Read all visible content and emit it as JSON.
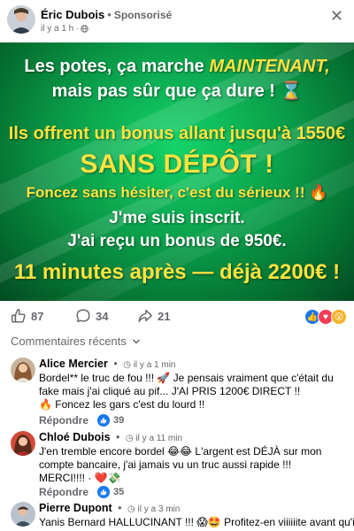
{
  "post": {
    "author": "Éric Dubois",
    "sponsored": "Sponsorisé",
    "time": "il y a 1 h ·"
  },
  "banner": {
    "line1_a": "Les potes, ça marche ",
    "line1_b": "MAINTENANT,",
    "line2": "mais pas sûr que ça dure ! ⌛",
    "line3": "Ils offrent un bonus allant jusqu'à 1550€",
    "line4": "SANS DÉPÔT !",
    "line5": "Foncez sans hésiter, c'est du sérieux !! 🔥",
    "line6": "J'me suis inscrit.",
    "line7": "J'ai reçu un bonus de 950€.",
    "line8": "11 minutes après — déjà 2200€ !"
  },
  "reactions": {
    "likes": "87",
    "comments": "34",
    "shares": "21"
  },
  "comments_header": "Commentaires récents",
  "comments": [
    {
      "name": "Alice Mercier",
      "time": "il y a 1 min",
      "text": "Bordel** le truc de fou !!! 🚀 Je pensais vraiment que c'était du fake mais j'ai cliqué au pif... J'AI PRIS 1200€ DIRECT !!\n🔥 Foncez les gars c'est du lourd !!",
      "reply": "Répondre",
      "likes": "39"
    },
    {
      "name": "Chloé Dubois",
      "time": "il y a 11 min",
      "text": "J'en tremble encore bordel 😂😂  L'argent est DÉJÀ sur mon compte bancaire, j'ai jamais vu un truc aussi rapide !!!\nMERCI!!!! · ❤️💸",
      "reply": "Répondre",
      "likes": "35"
    },
    {
      "name": "Pierre Dupont",
      "time": "il y a 3 min",
      "text": "Yanis Bernard HALLUCINANT !!! 😱🤩 Profitez-en viiiiiite avant qu'ils",
      "reply": "",
      "likes": ""
    }
  ],
  "colors": {
    "accent": "#1877f2",
    "banner_green": "#0a9e4a",
    "banner_yellow": "#ffe340",
    "muted": "#65676b"
  }
}
